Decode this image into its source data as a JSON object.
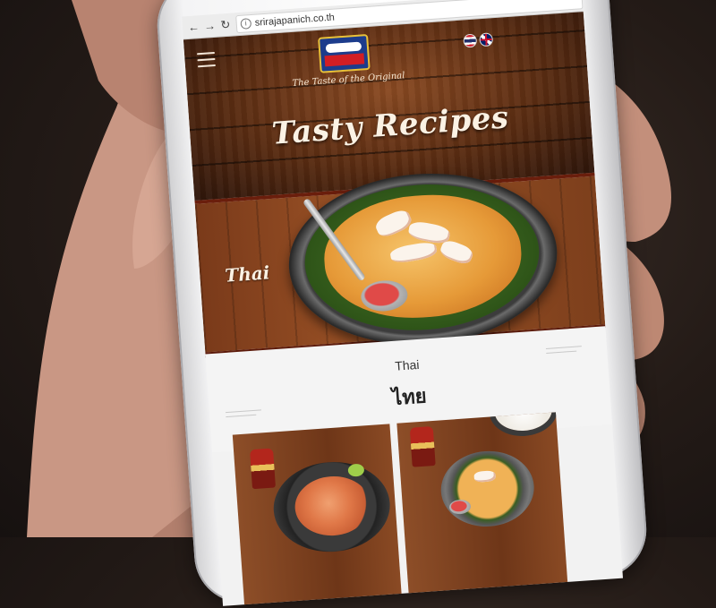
{
  "browser": {
    "back_glyph": "←",
    "forward_glyph": "→",
    "reload_glyph": "↻",
    "url": "srirajapanich.co.th"
  },
  "header": {
    "menu_icon": "hamburger-menu-icon",
    "logo_icon": "sriraja-panich-logo",
    "tagline": "The Taste of the Original",
    "languages": [
      "Thai",
      "English"
    ],
    "title": "Tasty Recipes"
  },
  "banner": {
    "category_label": "Thai"
  },
  "section": {
    "title_en": "Thai",
    "title_th": "ไทย"
  },
  "recipes": {
    "cards": [
      "recipe-card-1",
      "recipe-card-2"
    ]
  }
}
